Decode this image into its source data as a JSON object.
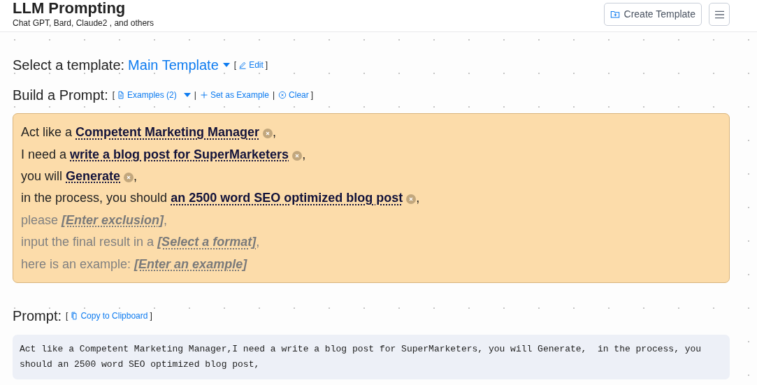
{
  "header": {
    "title": "LLM Prompting",
    "subtitle": "Chat GPT, Bard, Claude2 , and others",
    "buttons": [
      {
        "kind": "labeled",
        "label": "Create Template"
      },
      {
        "kind": "menu"
      }
    ]
  },
  "template": {
    "label": "Select a template:",
    "value": "Main Template",
    "actions": [
      {
        "label": "Edit",
        "kind": "edit"
      }
    ]
  },
  "builder": {
    "label": "Build a Prompt:",
    "actions": [
      {
        "label": "Examples (2)",
        "kind": "examples",
        "dropdown": true
      },
      {
        "label": "Set as Example",
        "kind": "add",
        "dropdown": false
      },
      {
        "label": "Clear",
        "kind": "clear",
        "dropdown": false
      }
    ],
    "lines": [
      {
        "prefix": "Act like a",
        "slot": "Competent Marketing Manager",
        "filled": true,
        "suffix": ","
      },
      {
        "prefix": "I need a",
        "slot": "write a blog post for SuperMarketers",
        "filled": true,
        "suffix": ","
      },
      {
        "prefix": "you will",
        "slot": "Generate",
        "filled": true,
        "suffix": ","
      },
      {
        "prefix": "in the process, you should",
        "slot": "an 2500 word SEO optimized blog post",
        "filled": true,
        "suffix": ","
      },
      {
        "prefix": "please",
        "slot": "[Enter exclusion]",
        "filled": false,
        "suffix": ","
      },
      {
        "prefix": "input the final result in a",
        "slot": "[Select a format]",
        "filled": false,
        "suffix": ","
      },
      {
        "prefix": "here is an example:",
        "slot": "[Enter an example]",
        "filled": false
      }
    ]
  },
  "prompt": {
    "label": "Prompt:",
    "actions": [
      {
        "label": "Copy to Clipboard",
        "kind": "copy"
      }
    ],
    "text": "Act like a Competent Marketing Manager,I need a write a blog post for SuperMarketers, you will Generate,  in the process, you should an 2500 word SEO optimized blog post,"
  },
  "brackets": {
    "open": "[",
    "close": "]",
    "separator": "|"
  }
}
